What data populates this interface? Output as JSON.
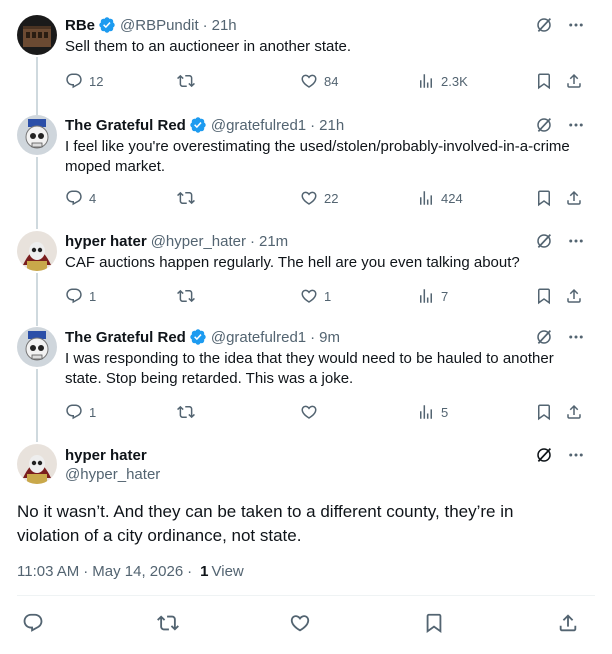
{
  "colors": {
    "verified": "#1d9bf0",
    "muted": "#536471",
    "text": "#0f1419",
    "thread_line": "#cfd9de"
  },
  "replies": [
    {
      "name": "RBe",
      "verified": true,
      "handle": "@RBPundit",
      "time": "21h",
      "text": "Sell them to an auctioneer in another state.",
      "reply_count": "12",
      "retweet_count": "",
      "like_count": "84",
      "view_count": "2.3K"
    },
    {
      "name": "The Grateful Red",
      "verified": true,
      "handle": "@gratefulred1",
      "time": "21h",
      "text": "I feel like you're overestimating the used/stolen/probably-involved-in-a-crime moped market.",
      "reply_count": "4",
      "retweet_count": "",
      "like_count": "22",
      "view_count": "424"
    },
    {
      "name": "hyper hater",
      "verified": false,
      "handle": "@hyper_hater",
      "time": "21m",
      "text": "CAF auctions happen regularly. The hell are you even talking about?",
      "reply_count": "1",
      "retweet_count": "",
      "like_count": "1",
      "view_count": "7"
    },
    {
      "name": "The Grateful Red",
      "verified": true,
      "handle": "@gratefulred1",
      "time": "9m",
      "text": "I was responding to the idea that they would need to be hauled to another state.  Stop being retarded.  This was a joke.",
      "reply_count": "1",
      "retweet_count": "",
      "like_count": "",
      "view_count": "5"
    }
  ],
  "main_tweet": {
    "name": "hyper hater",
    "handle": "@hyper_hater",
    "text": "No it wasn’t. And they can be taken to a different county, they’re in violation of a city ordinance, not state.",
    "time": "11:03 AM",
    "date": "May 14, 2026",
    "views": "1",
    "views_label": "View"
  },
  "icons": {
    "grok": "grok-icon",
    "more": "more-icon",
    "reply": "reply-icon",
    "retweet": "retweet-icon",
    "like": "like-icon",
    "views": "views-icon",
    "bookmark": "bookmark-icon",
    "share": "share-icon"
  }
}
